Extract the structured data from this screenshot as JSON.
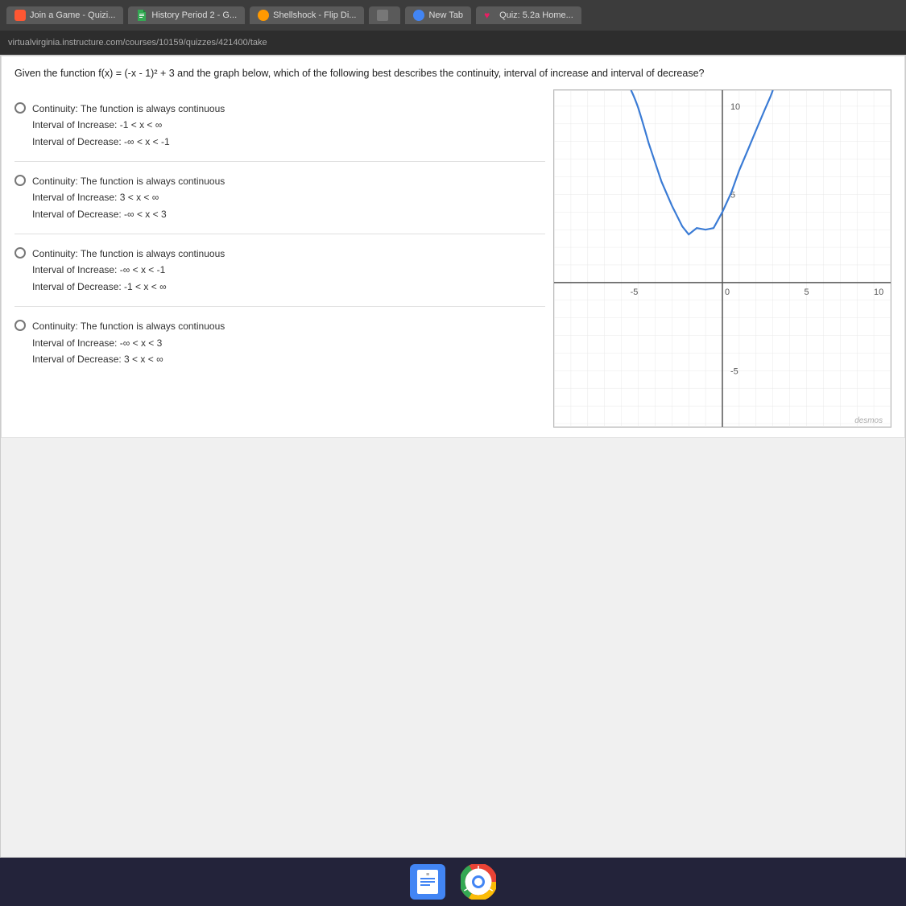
{
  "browser": {
    "url": "virtualvirginia.instructure.com/courses/10159/quizzes/421400/take",
    "tabs": [
      {
        "label": "Join a Game - Quizi...",
        "icon": "quiziz"
      },
      {
        "label": "History Period 2 - G...",
        "icon": "docs"
      },
      {
        "label": "Shellshock - Flip Di...",
        "icon": "shell"
      },
      {
        "label": "",
        "icon": "unknown"
      },
      {
        "label": "New Tab",
        "icon": "tab"
      },
      {
        "label": "Quiz: 5.2a Home...",
        "icon": "heart"
      }
    ]
  },
  "question": {
    "text": "Given the function f(x) = (-x - 1)² + 3 and the graph below, which of the following best describes the continuity, interval of increase and interval of decrease?",
    "graph": {
      "xmin": -10,
      "xmax": 10,
      "ymin": -7,
      "ymax": 12,
      "labels": {
        "x5": "5",
        "xneg5": "-5",
        "x0": "0",
        "x10": "10",
        "y5": "5",
        "y10": "10",
        "yneg5": "-5"
      }
    },
    "choices": [
      {
        "id": "a",
        "continuity": "Continuity: The function is always continuous",
        "increase": "Interval of Increase: -1 < x < ∞",
        "decrease": "Interval of Decrease: -∞ < x < -1"
      },
      {
        "id": "b",
        "continuity": "Continuity: The function is always continuous",
        "increase": "Interval of Increase: 3 < x < ∞",
        "decrease": "Interval of Decrease: -∞ < x < 3"
      },
      {
        "id": "c",
        "continuity": "Continuity: The function is always continuous",
        "increase": "Interval of Increase: -∞ < x < -1",
        "decrease": "Interval of Decrease: -1 < x < ∞"
      },
      {
        "id": "d",
        "continuity": "Continuity: The function is always continuous",
        "increase": "Interval of Increase: -∞ < x < 3",
        "decrease": "Interval of Decrease: 3 < x < ∞"
      }
    ]
  },
  "taskbar": {
    "docs_label": "Google Docs",
    "chrome_label": "Chrome"
  }
}
